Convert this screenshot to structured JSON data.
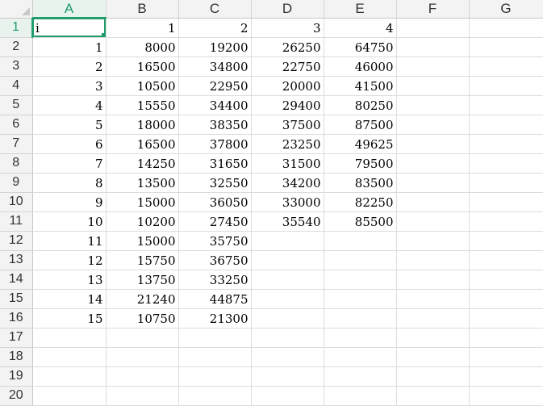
{
  "accent_color": "#1f9d6b",
  "sheet": {
    "columns": [
      "A",
      "B",
      "C",
      "D",
      "E",
      "F",
      "G"
    ],
    "rows": [
      {
        "row": "1",
        "cells": [
          "i",
          "1",
          "2",
          "3",
          "4",
          "",
          ""
        ]
      },
      {
        "row": "2",
        "cells": [
          "1",
          "8000",
          "19200",
          "26250",
          "64750",
          "",
          ""
        ]
      },
      {
        "row": "3",
        "cells": [
          "2",
          "16500",
          "34800",
          "22750",
          "46000",
          "",
          ""
        ]
      },
      {
        "row": "4",
        "cells": [
          "3",
          "10500",
          "22950",
          "20000",
          "41500",
          "",
          ""
        ]
      },
      {
        "row": "5",
        "cells": [
          "4",
          "15550",
          "34400",
          "29400",
          "80250",
          "",
          ""
        ]
      },
      {
        "row": "6",
        "cells": [
          "5",
          "18000",
          "38350",
          "37500",
          "87500",
          "",
          ""
        ]
      },
      {
        "row": "7",
        "cells": [
          "6",
          "16500",
          "37800",
          "23250",
          "49625",
          "",
          ""
        ]
      },
      {
        "row": "8",
        "cells": [
          "7",
          "14250",
          "31650",
          "31500",
          "79500",
          "",
          ""
        ]
      },
      {
        "row": "9",
        "cells": [
          "8",
          "13500",
          "32550",
          "34200",
          "83500",
          "",
          ""
        ]
      },
      {
        "row": "10",
        "cells": [
          "9",
          "15000",
          "36050",
          "33000",
          "82250",
          "",
          ""
        ]
      },
      {
        "row": "11",
        "cells": [
          "10",
          "10200",
          "27450",
          "35540",
          "85500",
          "",
          ""
        ]
      },
      {
        "row": "12",
        "cells": [
          "11",
          "15000",
          "35750",
          "",
          "",
          "",
          ""
        ]
      },
      {
        "row": "13",
        "cells": [
          "12",
          "15750",
          "36750",
          "",
          "",
          "",
          ""
        ]
      },
      {
        "row": "14",
        "cells": [
          "13",
          "13750",
          "33250",
          "",
          "",
          "",
          ""
        ]
      },
      {
        "row": "15",
        "cells": [
          "14",
          "21240",
          "44875",
          "",
          "",
          "",
          ""
        ]
      },
      {
        "row": "16",
        "cells": [
          "15",
          "10750",
          "21300",
          "",
          "",
          "",
          ""
        ]
      },
      {
        "row": "17",
        "cells": [
          "",
          "",
          "",
          "",
          "",
          "",
          ""
        ]
      },
      {
        "row": "18",
        "cells": [
          "",
          "",
          "",
          "",
          "",
          "",
          ""
        ]
      },
      {
        "row": "19",
        "cells": [
          "",
          "",
          "",
          "",
          "",
          "",
          ""
        ]
      },
      {
        "row": "20",
        "cells": [
          "",
          "",
          "",
          "",
          "",
          "",
          ""
        ]
      }
    ]
  }
}
